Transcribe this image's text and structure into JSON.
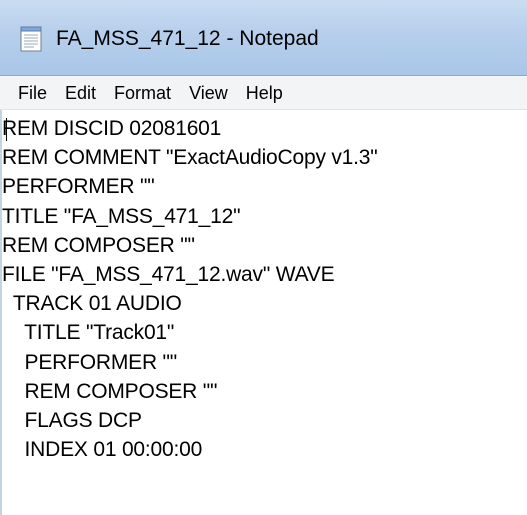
{
  "window": {
    "title": "FA_MSS_471_12 - Notepad",
    "icon": "notepad-icon"
  },
  "menubar": {
    "items": [
      "File",
      "Edit",
      "Format",
      "View",
      "Help"
    ]
  },
  "editor": {
    "lines": [
      "REM DISCID 02081601",
      "REM COMMENT \"ExactAudioCopy v1.3\"",
      "PERFORMER \"\"",
      "TITLE \"FA_MSS_471_12\"",
      "REM COMPOSER \"\"",
      "FILE \"FA_MSS_471_12.wav\" WAVE",
      "  TRACK 01 AUDIO",
      "    TITLE \"Track01\"",
      "    PERFORMER \"\"",
      "    REM COMPOSER \"\"",
      "    FLAGS DCP",
      "    INDEX 01 00:00:00"
    ]
  },
  "colors": {
    "titlebar": "#b7cfec",
    "menubar": "#f3f4f6",
    "text": "#000000"
  }
}
